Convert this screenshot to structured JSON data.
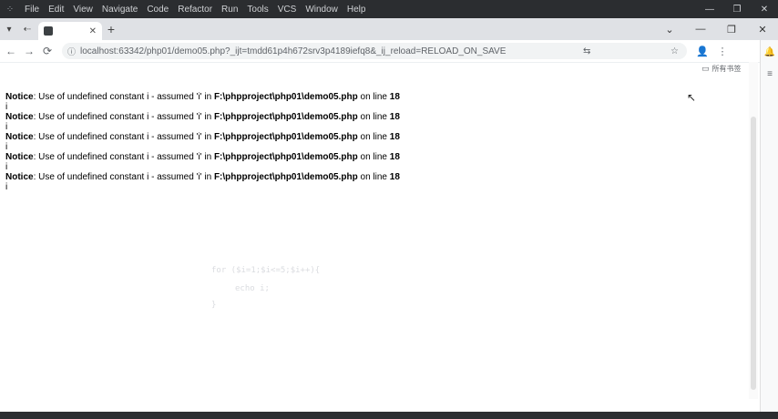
{
  "menubar": {
    "items": [
      "File",
      "Edit",
      "View",
      "Navigate",
      "Code",
      "Refactor",
      "Run",
      "Tools",
      "VCS",
      "Window",
      "Help"
    ],
    "window_buttons": [
      "—",
      "❐",
      "✕"
    ]
  },
  "tabstrip": {
    "tab_close": "✕",
    "new_tab": "+",
    "window_buttons": [
      "⌄",
      "—",
      "❐",
      "✕"
    ]
  },
  "toolbar": {
    "back": "←",
    "forward": "→",
    "reload": "⟳",
    "url": "localhost:63342/php01/demo05.php?_ijt=tmdd61p4h672srv3p4189iefq8&_ij_reload=RELOAD_ON_SAVE"
  },
  "bookmarks": {
    "label": "所有书签"
  },
  "notices": [
    {
      "label": "Notice",
      "message": ": Use of undefined constant i - assumed 'i' in ",
      "path": "F:\\phpproject\\php01\\demo05.php",
      "suffix": " on line ",
      "line": "18",
      "value": "i"
    },
    {
      "label": "Notice",
      "message": ": Use of undefined constant i - assumed 'i' in ",
      "path": "F:\\phpproject\\php01\\demo05.php",
      "suffix": " on line ",
      "line": "18",
      "value": "i"
    },
    {
      "label": "Notice",
      "message": ": Use of undefined constant i - assumed 'i' in ",
      "path": "F:\\phpproject\\php01\\demo05.php",
      "suffix": " on line ",
      "line": "18",
      "value": "i"
    },
    {
      "label": "Notice",
      "message": ": Use of undefined constant i - assumed 'i' in ",
      "path": "F:\\phpproject\\php01\\demo05.php",
      "suffix": " on line ",
      "line": "18",
      "value": "i"
    },
    {
      "label": "Notice",
      "message": ": Use of undefined constant i - assumed 'i' in ",
      "path": "F:\\phpproject\\php01\\demo05.php",
      "suffix": " on line ",
      "line": "18",
      "value": "i"
    }
  ],
  "ghost_code": {
    "line1": "for ($i=1;$i<=5;$i++){",
    "line2": "echo i;",
    "line3": "}"
  },
  "colors": {
    "menubar_bg": "#2b2d30",
    "tabstrip_bg": "#dfe1e5",
    "omnibox_bg": "#f1f3f4"
  }
}
